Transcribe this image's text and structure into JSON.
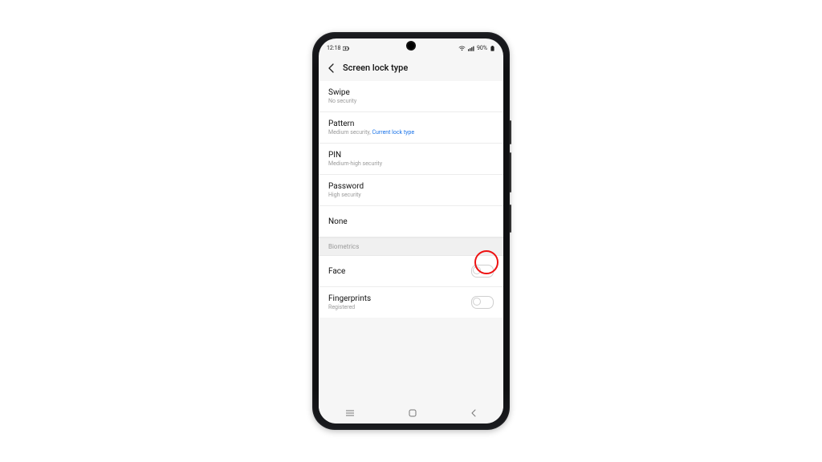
{
  "status": {
    "time": "12:18",
    "battery_pct": "90%"
  },
  "header": {
    "title": "Screen lock type"
  },
  "lock_options": {
    "swipe": {
      "label": "Swipe",
      "sub": "No security"
    },
    "pattern": {
      "label": "Pattern",
      "sub_prefix": "Medium security, ",
      "sub_current": "Current lock type"
    },
    "pin": {
      "label": "PIN",
      "sub": "Medium-high security"
    },
    "password": {
      "label": "Password",
      "sub": "High security"
    },
    "none": {
      "label": "None"
    }
  },
  "sections": {
    "biometrics": "Biometrics"
  },
  "biometrics": {
    "face": {
      "label": "Face"
    },
    "fingerprints": {
      "label": "Fingerprints",
      "sub": "Registered"
    }
  }
}
